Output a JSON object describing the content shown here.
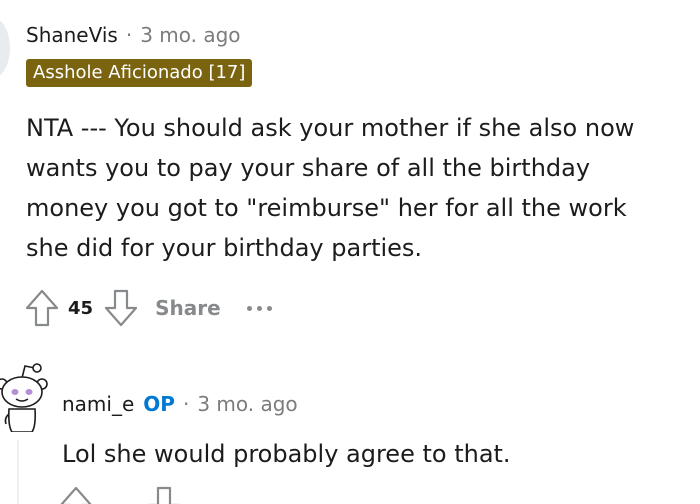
{
  "comments": [
    {
      "username": "ShaneVis",
      "time": "3 mo. ago",
      "flair": "Asshole Aficionado [17]",
      "flair_color": "#7b6410",
      "body_lines": [
        "NTA --- You should ask your mother if she also now",
        "wants you to pay your share of all the birthday",
        "money you got to \"reimburse\" her for all the work",
        "she did for your birthday parties."
      ],
      "votes": "45",
      "share_label": "Share",
      "icons": [
        "upvote-icon",
        "downvote-icon",
        "more-options-icon"
      ]
    },
    {
      "username": "nami_e",
      "op_badge": "OP",
      "op_color": "#0079d3",
      "time": "3 mo. ago",
      "body": "Lol she would probably agree to that.",
      "icons": [
        "snoo-avatar-icon",
        "upvote-icon",
        "downvote-icon"
      ]
    }
  ],
  "separator": "·"
}
